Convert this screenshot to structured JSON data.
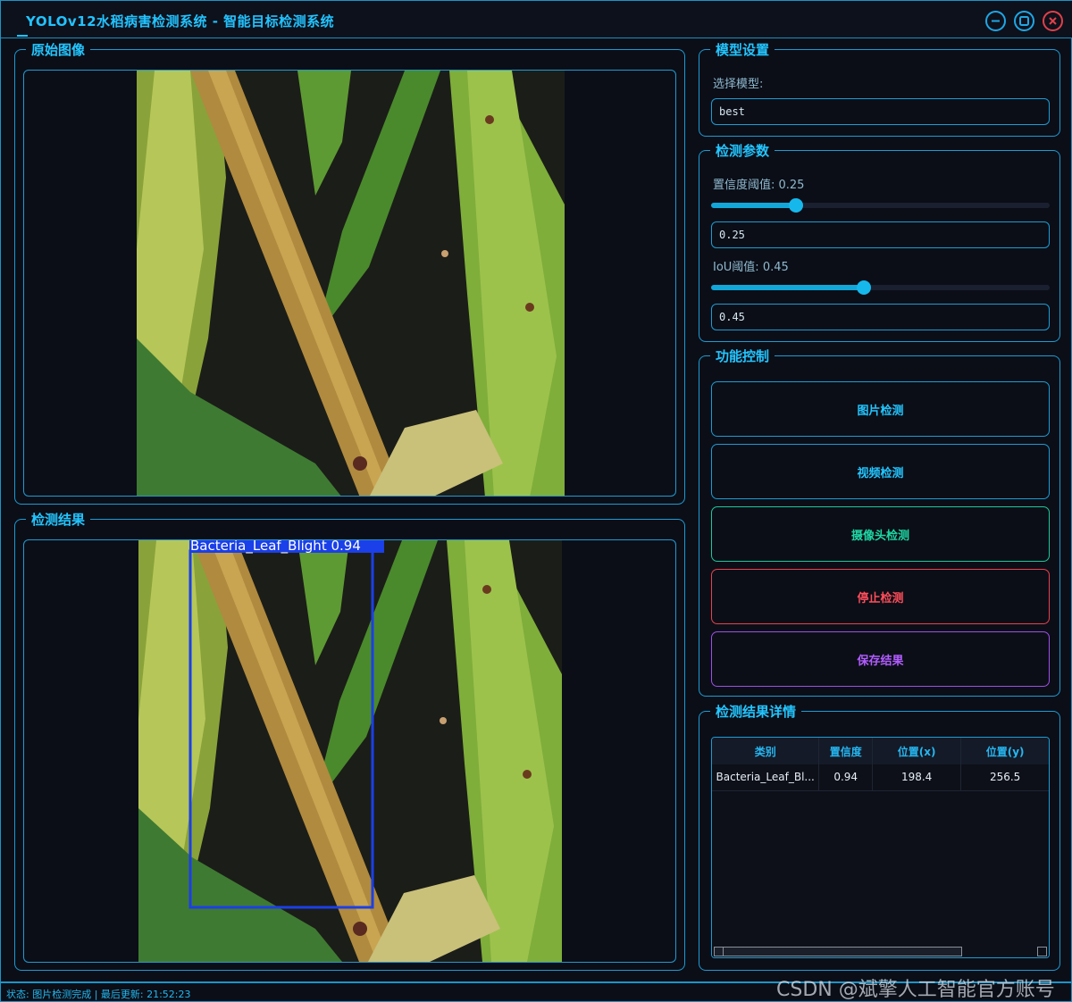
{
  "window": {
    "title": "YOLOv12水稻病害检测系统 - 智能目标检测系统"
  },
  "icons": {
    "minimize": "minimize-icon",
    "maximize": "maximize-icon",
    "close": "close-icon"
  },
  "original_panel": {
    "title": "原始图像"
  },
  "result_panel": {
    "title": "检测结果",
    "detection_label": "Bacteria_Leaf_Blight 0.94"
  },
  "model_settings": {
    "title": "模型设置",
    "select_label": "选择模型:",
    "selected_model": "best"
  },
  "detection_params": {
    "title": "检测参数",
    "confidence_label": "置信度阈值: 0.25",
    "confidence_value": "0.25",
    "confidence_fraction": 0.25,
    "iou_label": "IoU阈值: 0.45",
    "iou_value": "0.45",
    "iou_fraction": 0.45
  },
  "controls": {
    "title": "功能控制",
    "image_detect": "图片检测",
    "video_detect": "视频检测",
    "camera_detect": "摄像头检测",
    "stop_detect": "停止检测",
    "save_results": "保存结果"
  },
  "colors": {
    "accent": "#1ec8ff",
    "camera": "#1ed7a4",
    "stop": "#ff4d5a",
    "save": "#b25cff",
    "bbox": "#1b3fe8"
  },
  "results_table": {
    "title": "检测结果详情",
    "columns": [
      "类别",
      "置信度",
      "位置(x)",
      "位置(y)"
    ],
    "rows": [
      [
        "Bacteria_Leaf_Bl...",
        "0.94",
        "198.4",
        "256.5"
      ]
    ]
  },
  "status": {
    "text": "状态: 图片检测完成 | 最后更新: 21:52:23"
  },
  "watermark": "CSDN @斌擎人工智能官方账号"
}
